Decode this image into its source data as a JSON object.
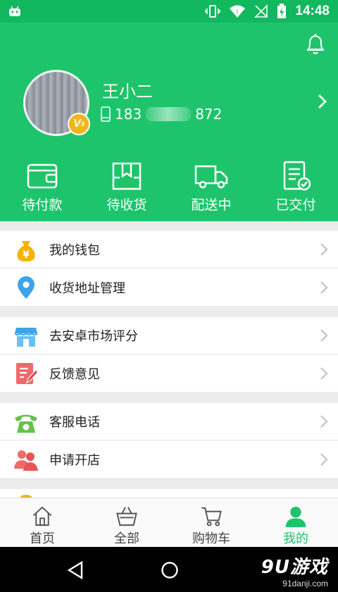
{
  "status": {
    "time": "14:48"
  },
  "profile": {
    "name": "王小二",
    "phone_prefix": "183",
    "phone_suffix": "872",
    "vip_letter": "V",
    "vip_level": "3"
  },
  "orders": [
    {
      "label": "待付款",
      "icon": "wallet-icon"
    },
    {
      "label": "待收货",
      "icon": "package-icon"
    },
    {
      "label": "配送中",
      "icon": "truck-icon"
    },
    {
      "label": "已交付",
      "icon": "delivered-icon"
    }
  ],
  "menu_groups": [
    [
      {
        "label": "我的钱包",
        "icon": "money-bag-icon"
      },
      {
        "label": "收货地址管理",
        "icon": "location-pin-icon"
      }
    ],
    [
      {
        "label": "去安卓市场评分",
        "icon": "store-icon"
      },
      {
        "label": "反馈意见",
        "icon": "feedback-icon"
      }
    ],
    [
      {
        "label": "客服电话",
        "icon": "phone-icon"
      },
      {
        "label": "申请开店",
        "icon": "users-icon"
      }
    ]
  ],
  "tabs": [
    {
      "label": "首页",
      "icon": "home-icon"
    },
    {
      "label": "全部",
      "icon": "basket-icon"
    },
    {
      "label": "购物车",
      "icon": "cart-icon"
    },
    {
      "label": "我的",
      "icon": "user-icon",
      "active": true
    }
  ],
  "watermark": {
    "brand": "9U游戏",
    "site": "91danji.com"
  },
  "colors": {
    "primary": "#1ec46b",
    "status_bar": "#12b85e",
    "vip_badge": "#f2b41c"
  }
}
